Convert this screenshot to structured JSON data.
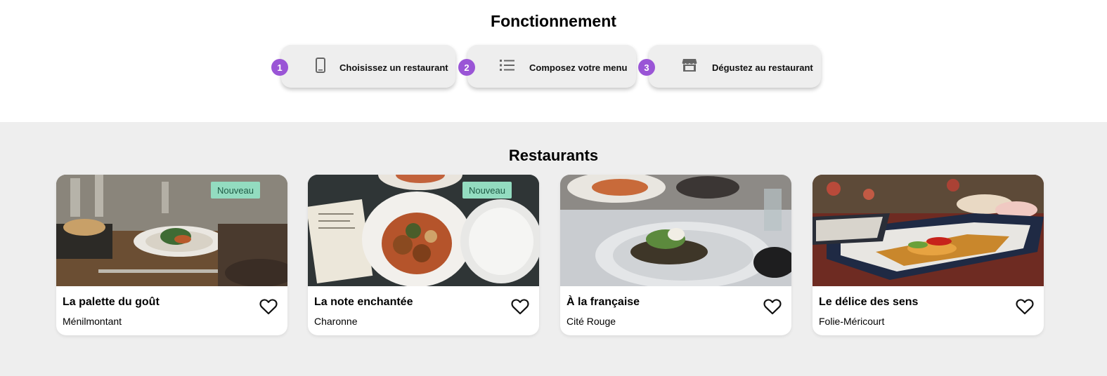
{
  "how_it_works": {
    "title": "Fonctionnement",
    "steps": [
      {
        "number": "1",
        "icon": "smartphone-icon",
        "label": "Choisissez un restaurant"
      },
      {
        "number": "2",
        "icon": "list-icon",
        "label": "Composez votre menu"
      },
      {
        "number": "3",
        "icon": "store-icon",
        "label": "Dégustez au restaurant"
      }
    ]
  },
  "restaurants": {
    "title": "Restaurants",
    "items": [
      {
        "name": "La palette du goût",
        "area": "Ménilmontant",
        "badge": "Nouveau",
        "favorite_icon": "heart-outline-icon"
      },
      {
        "name": "La note enchantée",
        "area": "Charonne",
        "badge": "Nouveau",
        "favorite_icon": "heart-outline-icon"
      },
      {
        "name": "À la française",
        "area": "Cité Rouge",
        "badge": "",
        "favorite_icon": "heart-outline-icon"
      },
      {
        "name": "Le délice des sens",
        "area": "Folie-Méricourt",
        "badge": "",
        "favorite_icon": "heart-outline-icon"
      }
    ]
  },
  "colors": {
    "step_number_bg": "#9a55d6",
    "badge_bg": "#93dcc0",
    "section_bg": "#eeeeee"
  }
}
